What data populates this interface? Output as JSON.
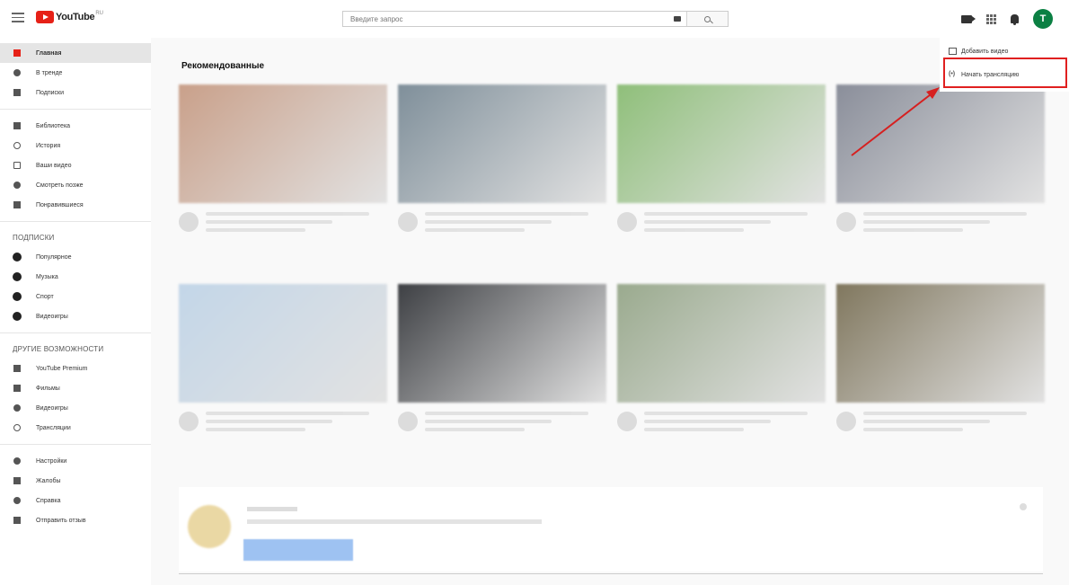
{
  "header": {
    "logo_text": "YouTube",
    "logo_sup": "RU",
    "search_placeholder": "Введите запрос",
    "avatar_letter": "T"
  },
  "sidebar": {
    "main_items": [
      {
        "label": "Главная",
        "icon": "home-icon",
        "active": true
      },
      {
        "label": "В тренде",
        "icon": "trending-icon"
      },
      {
        "label": "Подписки",
        "icon": "subscriptions-icon"
      }
    ],
    "library_items": [
      {
        "label": "Библиотека",
        "icon": "library-icon"
      },
      {
        "label": "История",
        "icon": "history-icon"
      },
      {
        "label": "Ваши видео",
        "icon": "your-videos-icon"
      },
      {
        "label": "Смотреть позже",
        "icon": "watch-later-icon"
      },
      {
        "label": "Понравившиеся",
        "icon": "like-icon"
      }
    ],
    "subscriptions_title": "ПОДПИСКИ",
    "subscriptions": [
      {
        "label": "Популярное"
      },
      {
        "label": "Музыка"
      },
      {
        "label": "Спорт"
      },
      {
        "label": "Видеоигры"
      }
    ],
    "more_title": "ДРУГИЕ ВОЗМОЖНОСТИ",
    "more_items": [
      {
        "label": "YouTube Premium",
        "icon": "youtube-icon"
      },
      {
        "label": "Фильмы",
        "icon": "film-icon"
      },
      {
        "label": "Видеоигры",
        "icon": "gaming-icon"
      },
      {
        "label": "Трансляции",
        "icon": "live-icon"
      }
    ],
    "settings_items": [
      {
        "label": "Настройки",
        "icon": "gear-icon"
      },
      {
        "label": "Жалобы",
        "icon": "flag-icon"
      },
      {
        "label": "Справка",
        "icon": "help-icon"
      },
      {
        "label": "Отправить отзыв",
        "icon": "feedback-icon"
      }
    ]
  },
  "main": {
    "section_title": "Рекомендованные",
    "thumb_colors": [
      "#c9a08a",
      "#7f8f9a",
      "#8fbf7a",
      "#8a8e9a",
      "#c3d6e8",
      "#3e4044",
      "#9aaa8e",
      "#80775e"
    ]
  },
  "dropdown": {
    "add_video": "Добавить видео",
    "start_stream": "Начать трансляцию"
  }
}
